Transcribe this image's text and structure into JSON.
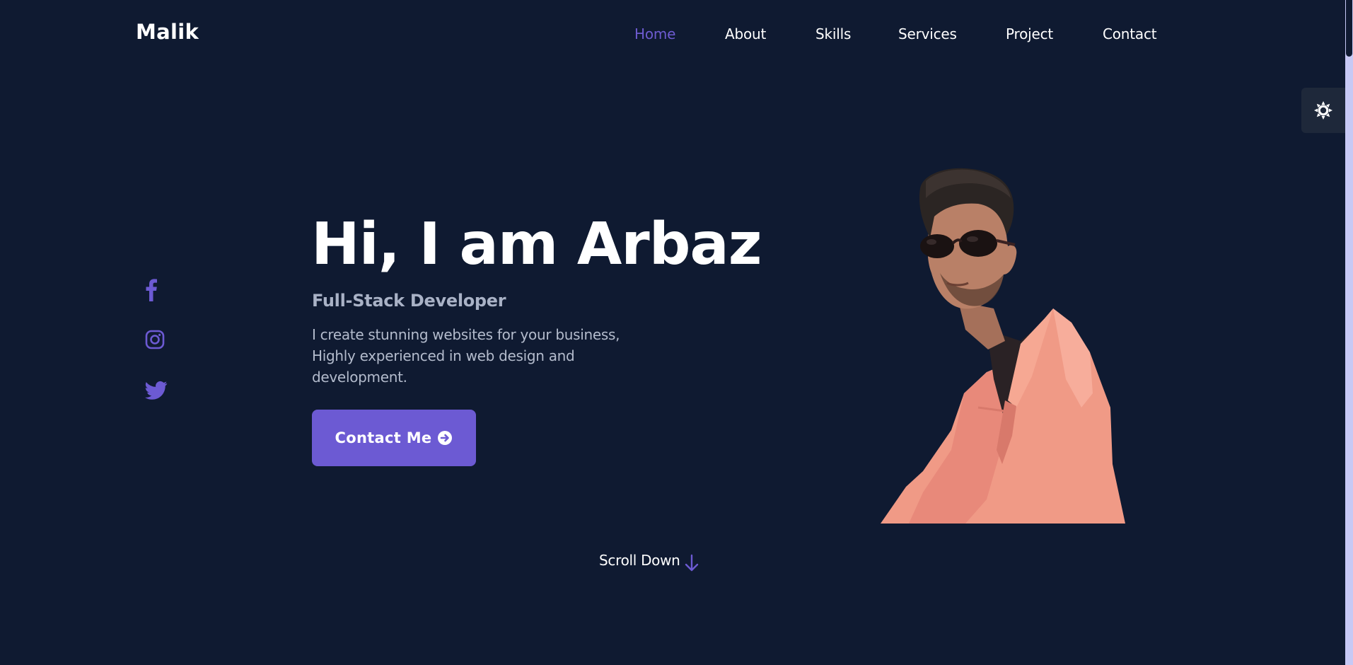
{
  "header": {
    "logo": "Malik",
    "nav": [
      {
        "label": "Home",
        "active": true
      },
      {
        "label": "About",
        "active": false
      },
      {
        "label": "Skills",
        "active": false
      },
      {
        "label": "Services",
        "active": false
      },
      {
        "label": "Project",
        "active": false
      },
      {
        "label": "Contact",
        "active": false
      }
    ]
  },
  "theme_toggle": {
    "icon": "sun-icon"
  },
  "social": [
    {
      "name": "facebook",
      "icon": "facebook-icon"
    },
    {
      "name": "instagram",
      "icon": "instagram-icon"
    },
    {
      "name": "twitter",
      "icon": "twitter-icon"
    }
  ],
  "hero": {
    "title": "Hi, I am Arbaz",
    "subtitle": "Full-Stack Developer",
    "description": "I create stunning websites for your business, Highly experienced in web design and development.",
    "cta_label": "Contact Me",
    "cta_icon": "arrow-right-circle-icon"
  },
  "scroll_down": {
    "label": "Scroll Down",
    "icon": "arrow-down-icon"
  },
  "colors": {
    "background": "#0f1a31",
    "accent": "#6c5ad3",
    "text": "#ffffff",
    "muted_text": "#b3bbcc",
    "toggle_bg": "#1e283a"
  }
}
